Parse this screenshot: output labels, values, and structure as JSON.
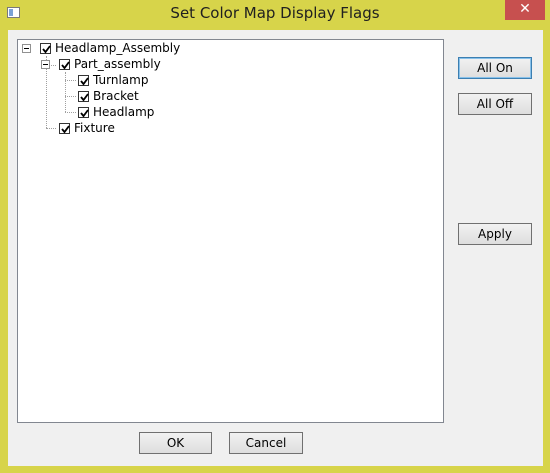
{
  "window": {
    "title": "Set Color Map Display Flags",
    "close_glyph": "✕"
  },
  "tree": {
    "root": {
      "label": "Headlamp_Assembly",
      "checked": true,
      "expanded": true
    },
    "part_assembly": {
      "label": "Part_assembly",
      "checked": true,
      "expanded": true
    },
    "turnlamp": {
      "label": "Turnlamp",
      "checked": true
    },
    "bracket": {
      "label": "Bracket",
      "checked": true
    },
    "headlamp": {
      "label": "Headlamp",
      "checked": true
    },
    "fixture": {
      "label": "Fixture",
      "checked": true
    }
  },
  "buttons": {
    "all_on": "All On",
    "all_off": "All Off",
    "apply": "Apply",
    "ok": "OK",
    "cancel": "Cancel"
  },
  "icons": {
    "checkbox": "check-icon",
    "expander": "minus-icon",
    "close": "close-icon"
  }
}
